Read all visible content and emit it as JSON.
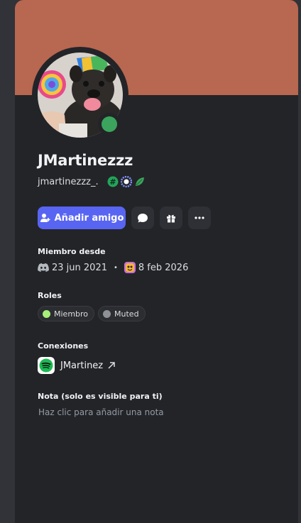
{
  "profile": {
    "display_name": "JMartinezzz",
    "username": "jmartinezzz_.",
    "status": "online",
    "banner_color": "#b86750",
    "badges": [
      "hashtag-badge",
      "gear-badge",
      "leaf-badge"
    ]
  },
  "actions": {
    "add_friend_label": "Añadir amigo",
    "message_icon": "chat-bubble-icon",
    "gift_icon": "gift-icon",
    "more_icon": "ellipsis-icon"
  },
  "member_since": {
    "label": "Miembro desde",
    "discord_date": "23 jun 2021",
    "separator": "•",
    "server_date": "8 feb 2026"
  },
  "roles": {
    "label": "Roles",
    "items": [
      {
        "name": "Miembro",
        "color": "#a8f07a"
      },
      {
        "name": "Muted",
        "color": "#8e9297"
      }
    ]
  },
  "connections": {
    "label": "Conexiones",
    "items": [
      {
        "service": "spotify",
        "name": "JMartinez"
      }
    ]
  },
  "note": {
    "label": "Nota (solo es visible para ti)",
    "placeholder": "Haz clic para añadir una nota"
  }
}
